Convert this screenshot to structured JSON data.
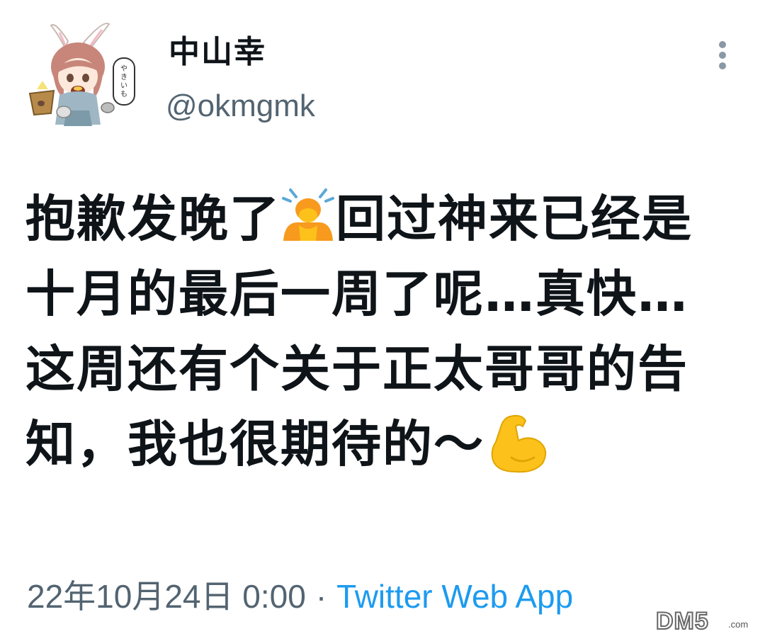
{
  "author": {
    "display_name": "中山幸",
    "handle": "@okmgmk",
    "avatar_speech_text": "やきいも"
  },
  "tweet": {
    "lines": [
      {
        "before": "抱歉发晚了",
        "emoji": "person-bowing-emoji",
        "after": "回过神来已经是"
      },
      {
        "before": "十月的最后一周了呢…真快…",
        "emoji": "",
        "after": ""
      },
      {
        "before": "这周还有个关于正太哥哥的告",
        "emoji": "",
        "after": ""
      },
      {
        "before": "知，我也很期待的～",
        "emoji": "flexed-biceps-emoji",
        "after": ""
      }
    ]
  },
  "meta": {
    "timestamp": "22年10月24日 0:00",
    "separator": "·",
    "source": "Twitter Web App"
  },
  "icons": {
    "more": "more-vertical-icon"
  },
  "colors": {
    "text_primary": "#0f1419",
    "text_secondary": "#536471",
    "link": "#1d9bf0",
    "emoji_yellow": "#fcc21b"
  },
  "watermark": {
    "text": "DM5",
    "suffix": ".com"
  }
}
